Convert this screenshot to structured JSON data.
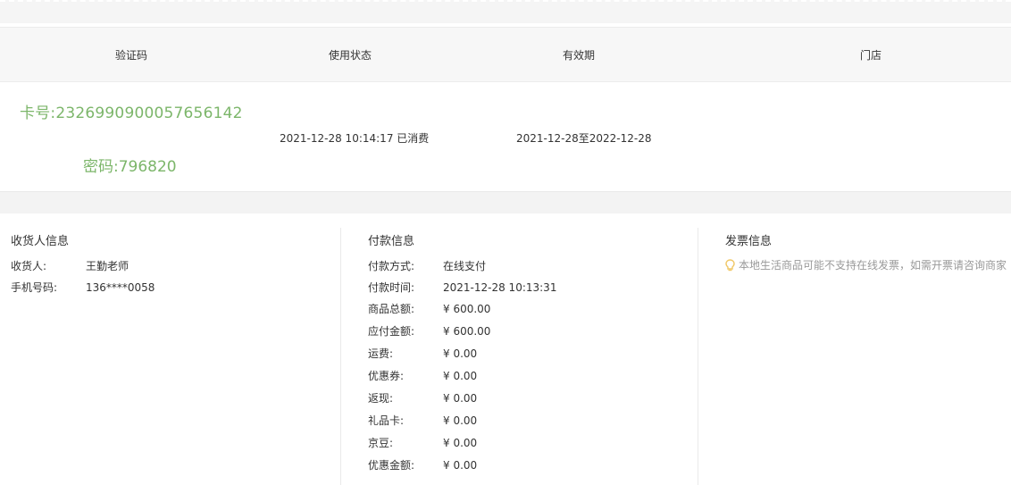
{
  "colors": {
    "accent_green": "#7cb66a",
    "header_bg": "#f7f7f7",
    "hint_icon": "#f0c766"
  },
  "table": {
    "headers": [
      "验证码",
      "使用状态",
      "有效期",
      "门店"
    ],
    "row": {
      "card_no": "卡号:2326990900057656142",
      "password": "密码:796820",
      "status": "2021-12-28 10:14:17 已消费",
      "validity": "2021-12-28至2022-12-28",
      "store": ""
    }
  },
  "receiver": {
    "title": "收货人信息",
    "fields": [
      {
        "label": "收货人:",
        "value": "王勤老师"
      },
      {
        "label": "手机号码:",
        "value": "136****0058"
      }
    ]
  },
  "payment": {
    "title": "付款信息",
    "fields": [
      {
        "label": "付款方式:",
        "value": "在线支付"
      },
      {
        "label": "付款时间:",
        "value": "2021-12-28 10:13:31"
      },
      {
        "label": "商品总额:",
        "value": "¥ 600.00"
      },
      {
        "label": "应付金额:",
        "value": "¥ 600.00"
      },
      {
        "label": "运费:",
        "value": "¥ 0.00"
      },
      {
        "label": "优惠券:",
        "value": "¥ 0.00"
      },
      {
        "label": "返现:",
        "value": "¥ 0.00"
      },
      {
        "label": "礼品卡:",
        "value": "¥ 0.00"
      },
      {
        "label": "京豆:",
        "value": "¥ 0.00"
      },
      {
        "label": "优惠金额:",
        "value": "¥ 0.00"
      }
    ]
  },
  "invoice": {
    "title": "发票信息",
    "hint": "本地生活商品可能不支持在线发票，如需开票请咨询商家",
    "hint_icon": "lightbulb-icon"
  }
}
